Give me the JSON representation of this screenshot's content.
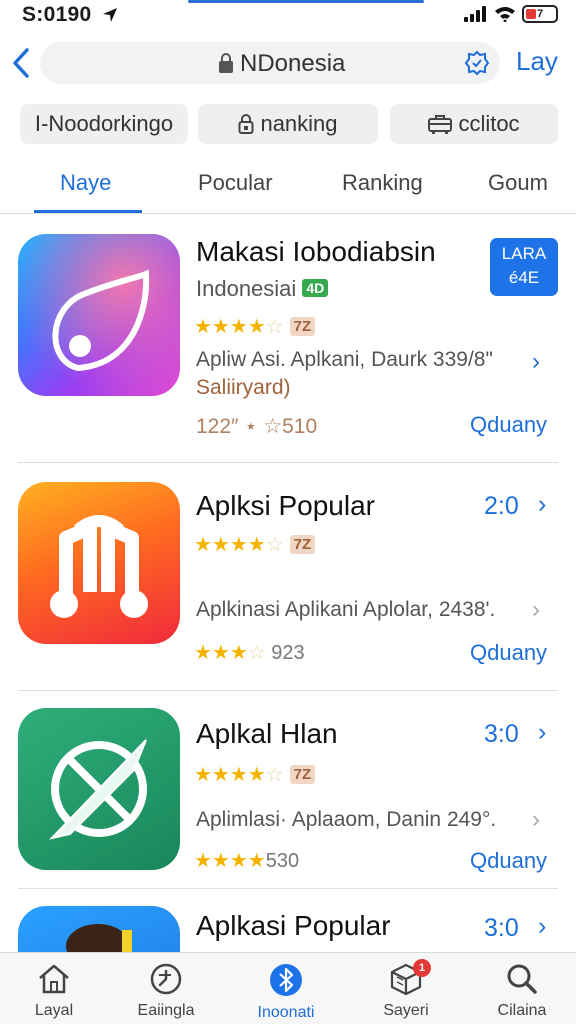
{
  "status_bar": {
    "time": "S:0190",
    "battery": "7"
  },
  "nav": {
    "back_icon": "chevron-left-icon",
    "url": "NDonesia",
    "right_action": "Lay"
  },
  "filters": [
    {
      "label": "I-Noodorkingo",
      "icon": ""
    },
    {
      "label": "nanking",
      "icon": "lock-icon"
    },
    {
      "label": "cclitoc",
      "icon": "briefcase-icon"
    }
  ],
  "tabs": [
    "Naye",
    "Pocular",
    "Ranking",
    "Goum"
  ],
  "active_tab": "Naye",
  "apps": [
    {
      "title": "Makasi Iobodiabsin",
      "subtitle": "Indonesiai",
      "subtitle_badge": "4D",
      "rating": 3.5,
      "rating_badge": "7Z",
      "description_line1": "Apliw Asi. Aplkani, Daurk 339/8\"",
      "description_line2": "Saliiryard)",
      "count": "122″ ⋆ ☆510",
      "action": "Qduany",
      "corner_box_line1": "LARA",
      "corner_box_line2": "é4E"
    },
    {
      "title": "Aplksi Popular",
      "price": "2:0",
      "rating": 3.5,
      "rating_badge": "7Z",
      "description": "Aplkinasi Aplikani Aplolar, 2438'.",
      "count": "923",
      "count_rating": 3,
      "action": "Qduany"
    },
    {
      "title": "Aplkal Hlan",
      "price": "3:0",
      "rating": 3.5,
      "rating_badge": "7Z",
      "description": "Aplimlasi· Aplaaom, Danin 249°.",
      "count": "530",
      "count_rating": 4,
      "action": "Qduany"
    },
    {
      "title": "Aplkasi Popular",
      "price": "3:0"
    }
  ],
  "tab_bar": [
    {
      "label": "Layal",
      "icon": "home-icon"
    },
    {
      "label": "Eaiingla",
      "icon": "clock-icon"
    },
    {
      "label": "Inoonati",
      "icon": "bluetooth-icon",
      "active": true
    },
    {
      "label": "Sayeri",
      "icon": "box-icon",
      "badge": "1"
    },
    {
      "label": "Cilaina",
      "icon": "search-icon"
    }
  ],
  "colors": {
    "accent": "#1e6fd9",
    "star": "#f5b301",
    "badge_red": "#e53935"
  }
}
